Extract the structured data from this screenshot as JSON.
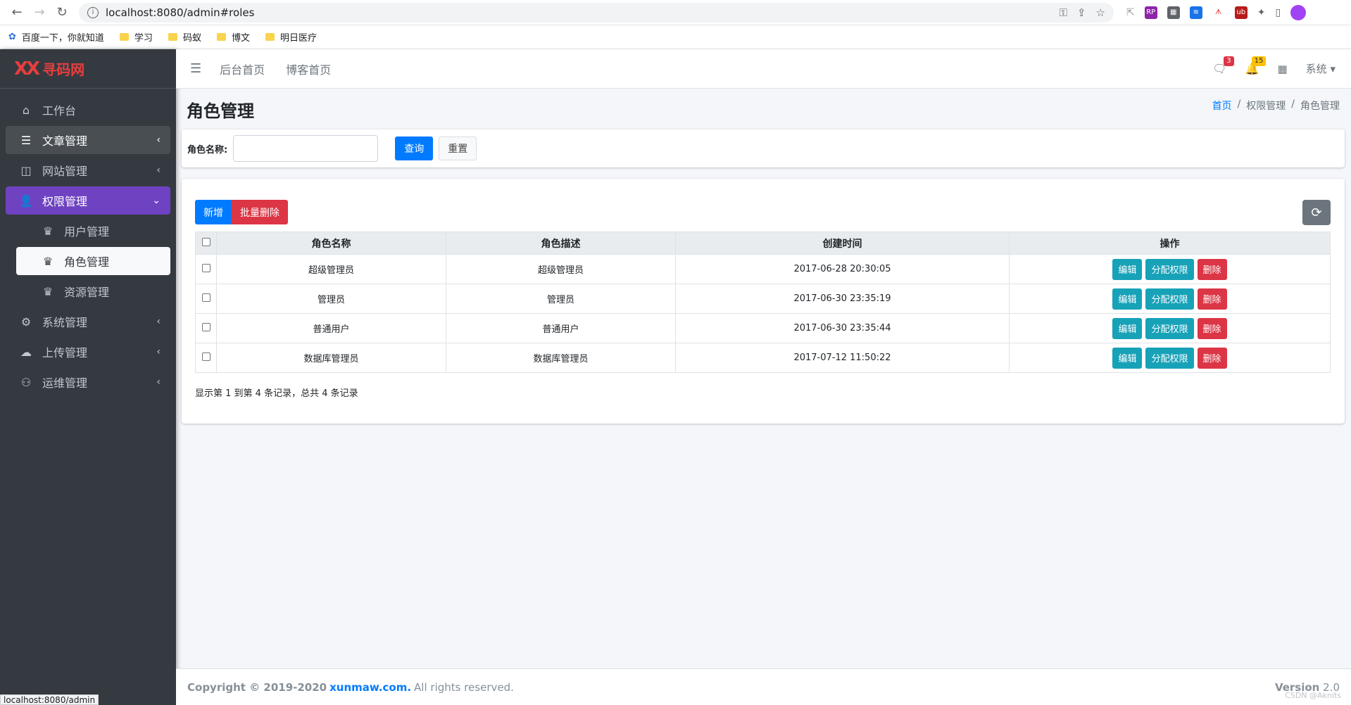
{
  "browser": {
    "url": "localhost:8080/admin#roles",
    "bookmarks": [
      "百度一下，你就知道",
      "学习",
      "码蚁",
      "博文",
      "明日医疗"
    ],
    "status_url": "localhost:8080/admin"
  },
  "brand": {
    "logo": "XX",
    "name": "寻码网"
  },
  "sidebar": {
    "items": [
      {
        "label": "工作台",
        "icon": "dashboard-icon"
      },
      {
        "label": "文章管理",
        "icon": "article-icon"
      },
      {
        "label": "网站管理",
        "icon": "website-icon"
      },
      {
        "label": "权限管理",
        "icon": "user-lock-icon"
      },
      {
        "label": "系统管理",
        "icon": "gear-icon"
      },
      {
        "label": "上传管理",
        "icon": "upload-icon"
      },
      {
        "label": "运维管理",
        "icon": "people-icon"
      }
    ],
    "sub_items": [
      {
        "label": "用户管理"
      },
      {
        "label": "角色管理"
      },
      {
        "label": "资源管理"
      }
    ]
  },
  "topnav": {
    "links": [
      "后台首页",
      "博客首页"
    ],
    "messages_count": "3",
    "notifications_count": "15",
    "system_label": "系统"
  },
  "page": {
    "title": "角色管理",
    "breadcrumb": [
      "首页",
      "权限管理",
      "角色管理"
    ]
  },
  "search": {
    "label": "角色名称:",
    "input_value": "",
    "query_label": "查询",
    "reset_label": "重置"
  },
  "toolbar": {
    "add_label": "新增",
    "batch_delete_label": "批量删除"
  },
  "table": {
    "headers": [
      "角色名称",
      "角色描述",
      "创建时间",
      "操作"
    ],
    "rows": [
      {
        "name": "超级管理员",
        "desc": "超级管理员",
        "created": "2017-06-28 20:30:05"
      },
      {
        "name": "管理员",
        "desc": "管理员",
        "created": "2017-06-30 23:35:19"
      },
      {
        "name": "普通用户",
        "desc": "普通用户",
        "created": "2017-06-30 23:35:44"
      },
      {
        "name": "数据库管理员",
        "desc": "数据库管理员",
        "created": "2017-07-12 11:50:22"
      }
    ],
    "action_labels": {
      "edit": "编辑",
      "assign": "分配权限",
      "delete": "删除"
    },
    "summary": "显示第 1 到第 4 条记录，总共 4 条记录"
  },
  "footer": {
    "copyright": "Copyright © 2019-2020",
    "site": "xunmaw.com.",
    "rights": "All rights reserved.",
    "version_label": "Version",
    "version": "2.0"
  },
  "watermark": "CSDN @Aknits"
}
